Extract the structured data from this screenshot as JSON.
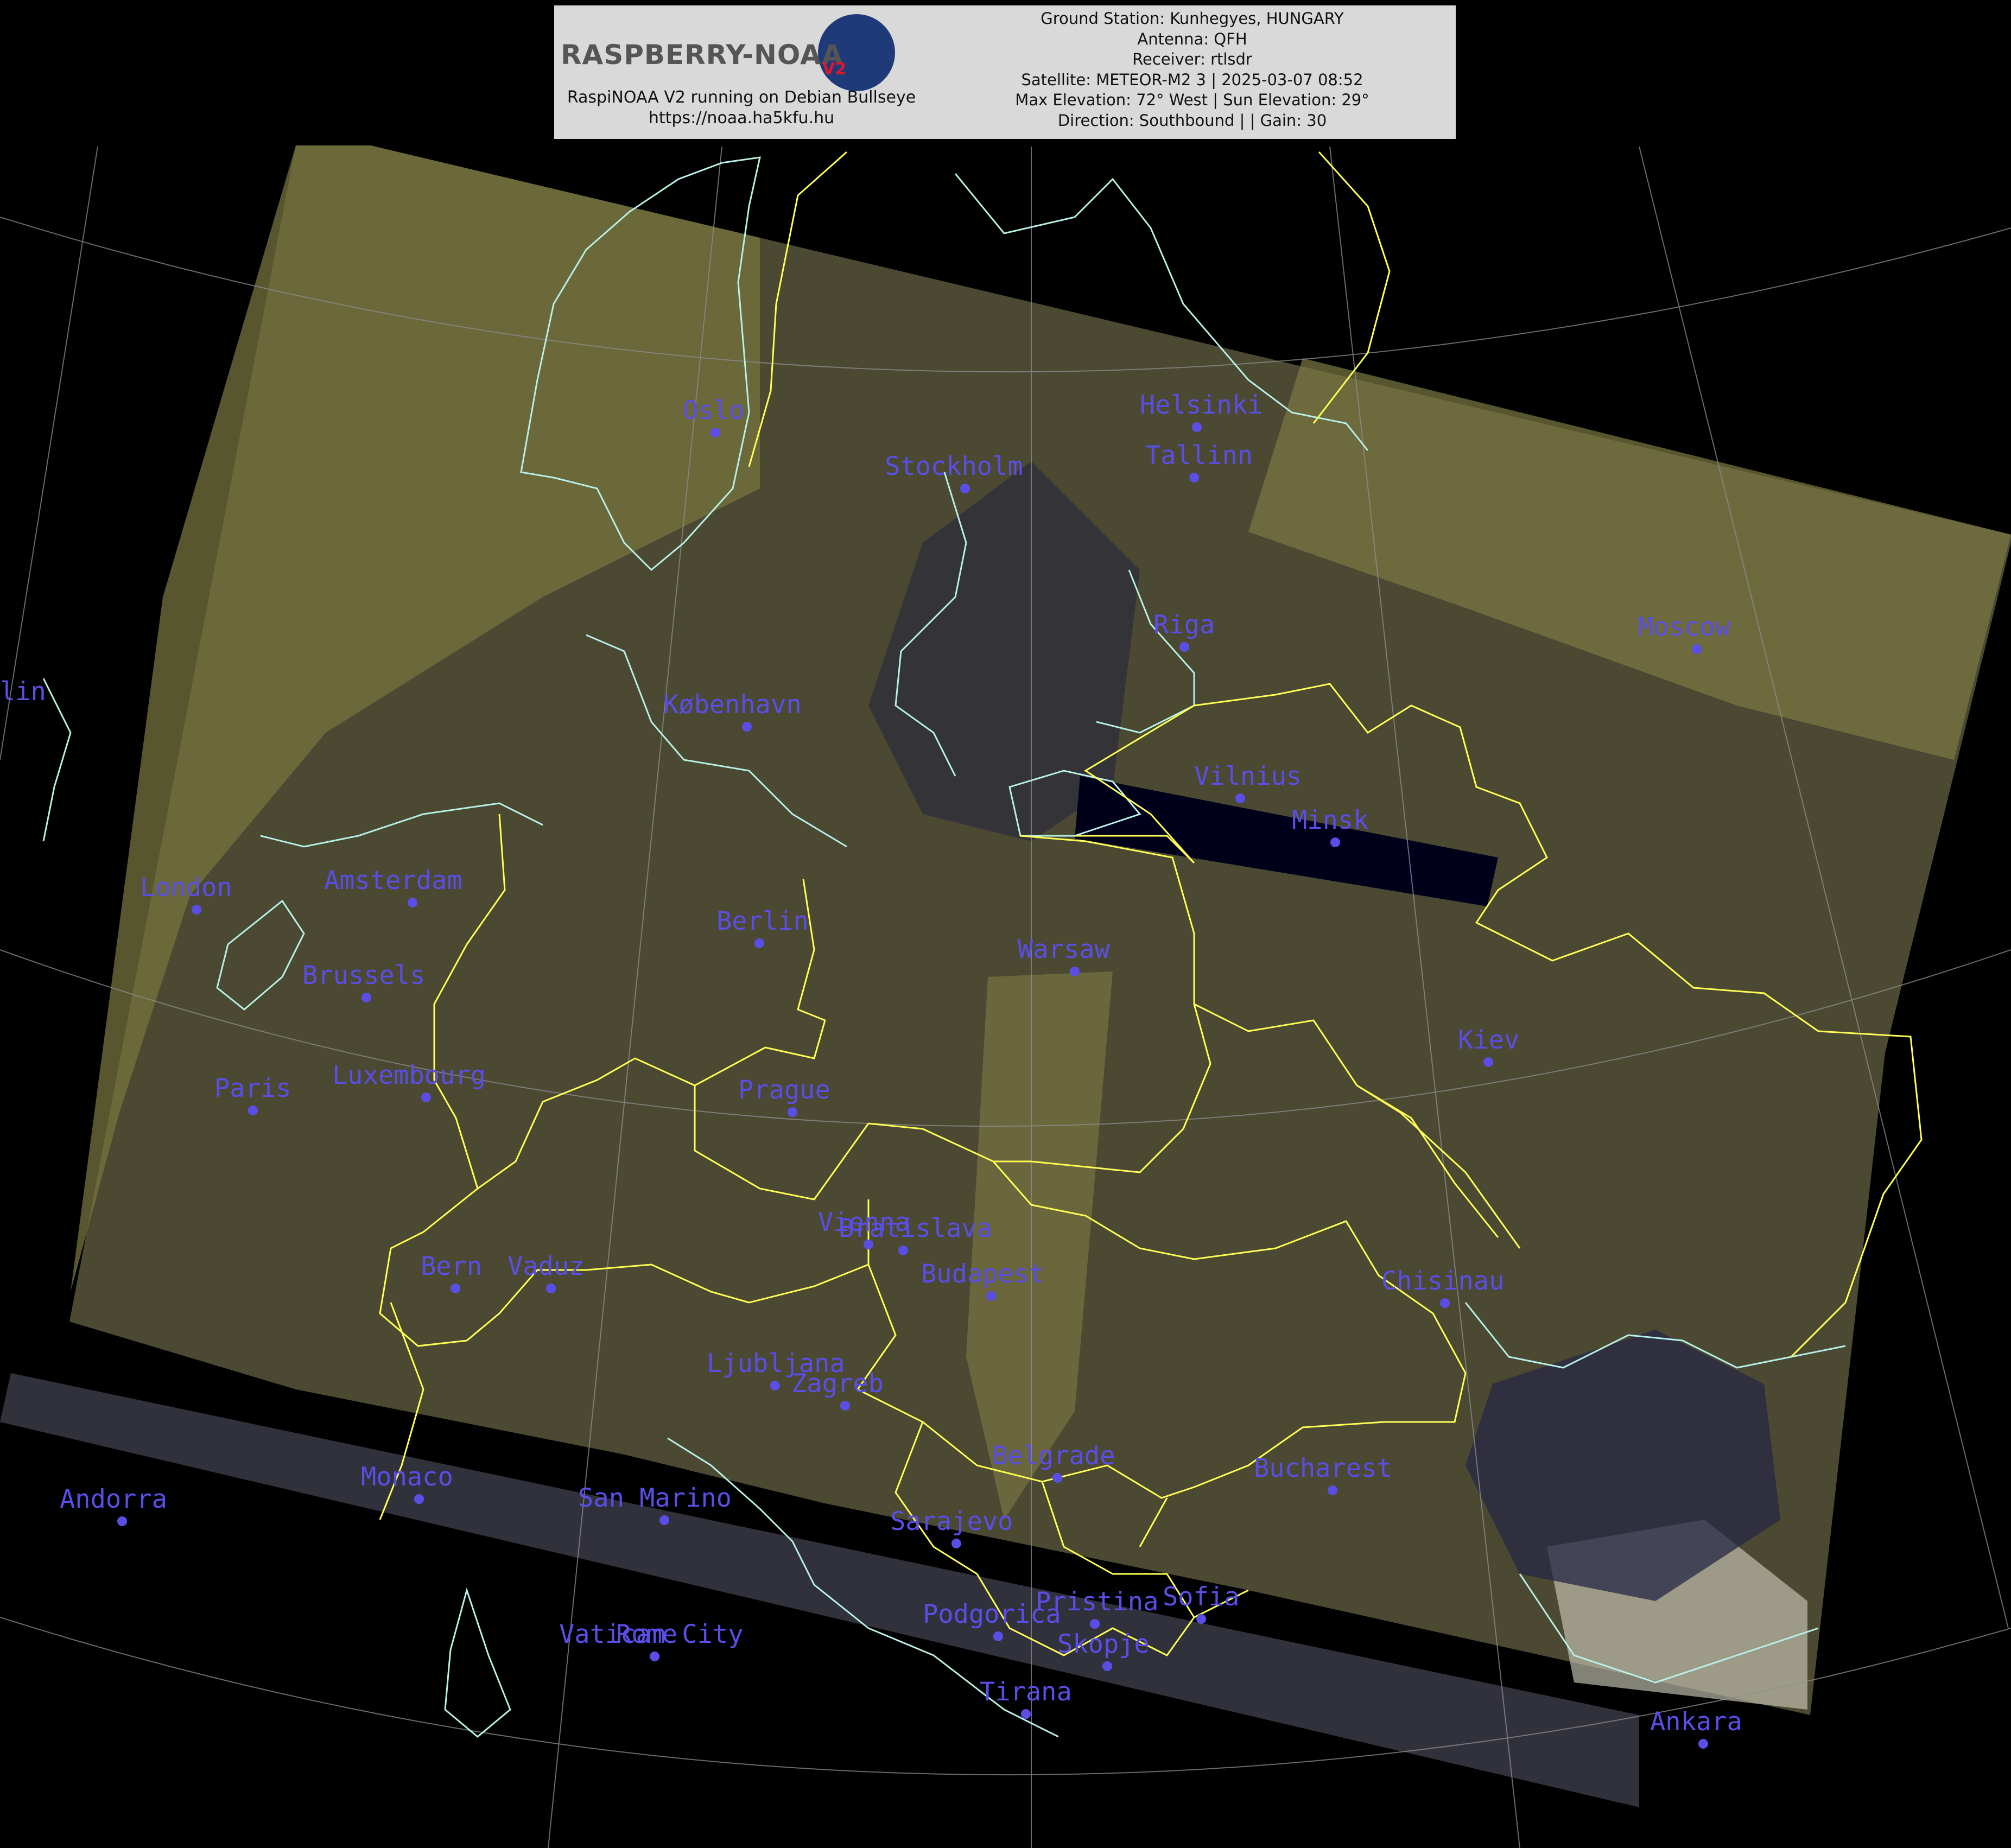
{
  "header": {
    "logo": "RASPBERRY-NOAA",
    "logo_version": "V2",
    "subtitle": "RaspiNOAA V2 running on Debian Bullseye",
    "url": "https://noaa.ha5kfu.hu",
    "info_lines": [
      "Ground Station: Kunhegyes, HUNGARY",
      "Antenna: QFH",
      "Receiver: rtlsdr",
      "Satellite: METEOR-M2 3 | 2025-03-07 08:52",
      "Max Elevation: 72° West | Sun Elevation: 29°",
      "Direction: Southbound | | Gain: 30"
    ]
  },
  "colors": {
    "label": "#5a4ee6",
    "border": "#ffff55",
    "coast": "#b6f0e6",
    "grid": "#9a9a9a",
    "imagery": "#4a4832",
    "background": "#000000"
  },
  "cities": [
    {
      "name": "Oslo"
    },
    {
      "name": "Stockholm"
    },
    {
      "name": "Helsinki"
    },
    {
      "name": "Tallinn"
    },
    {
      "name": "Riga"
    },
    {
      "name": "Moscow"
    },
    {
      "name": "København"
    },
    {
      "name": "Vilnius"
    },
    {
      "name": "Minsk"
    },
    {
      "name": "London"
    },
    {
      "name": "Amsterdam"
    },
    {
      "name": "Berlin"
    },
    {
      "name": "Warsaw"
    },
    {
      "name": "Brussels"
    },
    {
      "name": "Kiev"
    },
    {
      "name": "Luxembourg"
    },
    {
      "name": "Paris"
    },
    {
      "name": "Prague"
    },
    {
      "name": "Vienna"
    },
    {
      "name": "Bratislava"
    },
    {
      "name": "Budapest"
    },
    {
      "name": "Bern"
    },
    {
      "name": "Vaduz"
    },
    {
      "name": "Chisinau"
    },
    {
      "name": "Ljubljana"
    },
    {
      "name": "Zagreb"
    },
    {
      "name": "Belgrade"
    },
    {
      "name": "Bucharest"
    },
    {
      "name": "Andorra"
    },
    {
      "name": "Monaco"
    },
    {
      "name": "San Marino"
    },
    {
      "name": "Sarajevo"
    },
    {
      "name": "Podgorica"
    },
    {
      "name": "Pristina"
    },
    {
      "name": "Sofia"
    },
    {
      "name": "Vatican City"
    },
    {
      "name": "Rome"
    },
    {
      "name": "Skopje"
    },
    {
      "name": "Tirana"
    },
    {
      "name": "Ankara"
    },
    {
      "name": "Dublin"
    }
  ]
}
